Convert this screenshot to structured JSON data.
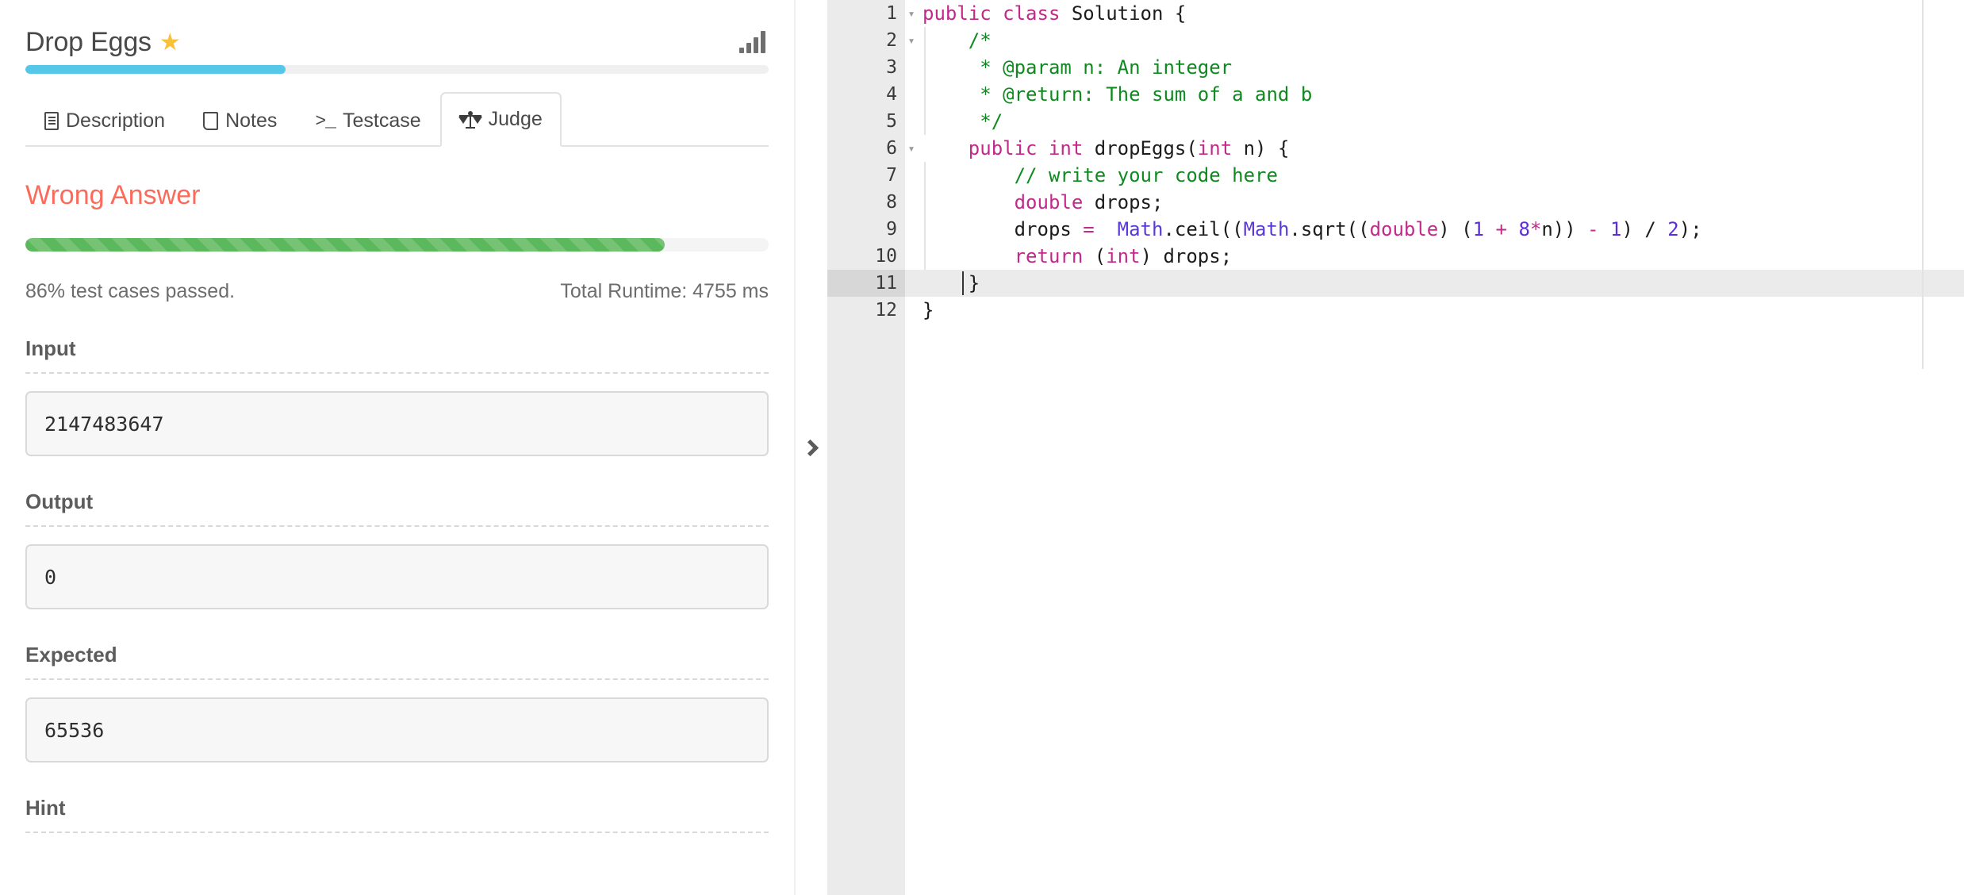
{
  "problem": {
    "title": "Drop Eggs",
    "star_icon": "star-icon",
    "favorite_marked": true,
    "signal_icon": "signal-bars-icon",
    "progress_percent": 35,
    "progress_color": "#55c8ea"
  },
  "tabs": [
    {
      "label": "Description",
      "icon": "document-icon",
      "active": false
    },
    {
      "label": "Notes",
      "icon": "note-icon",
      "active": false
    },
    {
      "label": "Testcase",
      "icon": "terminal-icon",
      "active": false
    },
    {
      "label": "Judge",
      "icon": "scales-icon",
      "active": true
    }
  ],
  "judge": {
    "verdict": "Wrong Answer",
    "verdict_color": "#fb6b5b",
    "pass_percent": 86,
    "pass_bar_color": "#5cb85c",
    "cases_passed_text": "86% test cases passed.",
    "runtime_text": "Total Runtime: 4755 ms",
    "sections": [
      {
        "label": "Input",
        "value": "2147483647"
      },
      {
        "label": "Output",
        "value": "0"
      },
      {
        "label": "Expected",
        "value": "65536"
      },
      {
        "label": "Hint",
        "value": ""
      }
    ]
  },
  "divider": {
    "collapse_icon": "chevron-right-icon"
  },
  "editor": {
    "language": "java",
    "active_line": 11,
    "total_lines": 12,
    "lines": [
      {
        "n": 1,
        "fold": true,
        "tokens": [
          {
            "t": "public class ",
            "c": "k"
          },
          {
            "t": "Solution {",
            "c": "pl"
          }
        ]
      },
      {
        "n": 2,
        "fold": true,
        "tokens": [
          {
            "t": "    ",
            "c": "pl"
          },
          {
            "t": "/*",
            "c": "cm"
          }
        ]
      },
      {
        "n": 3,
        "fold": false,
        "tokens": [
          {
            "t": "     ",
            "c": "pl"
          },
          {
            "t": "* @param n: An integer",
            "c": "cm"
          }
        ]
      },
      {
        "n": 4,
        "fold": false,
        "tokens": [
          {
            "t": "     ",
            "c": "pl"
          },
          {
            "t": "* @return: The sum of a and b",
            "c": "cm"
          }
        ]
      },
      {
        "n": 5,
        "fold": false,
        "tokens": [
          {
            "t": "     ",
            "c": "pl"
          },
          {
            "t": "*/",
            "c": "cm"
          }
        ]
      },
      {
        "n": 6,
        "fold": true,
        "tokens": [
          {
            "t": "    ",
            "c": "pl"
          },
          {
            "t": "public int ",
            "c": "k"
          },
          {
            "t": "dropEggs(",
            "c": "pl"
          },
          {
            "t": "int",
            "c": "k"
          },
          {
            "t": " n) {",
            "c": "pl"
          }
        ]
      },
      {
        "n": 7,
        "fold": false,
        "tokens": [
          {
            "t": "        ",
            "c": "pl"
          },
          {
            "t": "// write your code here",
            "c": "cm"
          }
        ]
      },
      {
        "n": 8,
        "fold": false,
        "tokens": [
          {
            "t": "        ",
            "c": "pl"
          },
          {
            "t": "double",
            "c": "k"
          },
          {
            "t": " drops;",
            "c": "pl"
          }
        ]
      },
      {
        "n": 9,
        "fold": false,
        "tokens": [
          {
            "t": "        drops ",
            "c": "pl"
          },
          {
            "t": "=",
            "c": "op"
          },
          {
            "t": "  ",
            "c": "pl"
          },
          {
            "t": "Math",
            "c": "cls"
          },
          {
            "t": ".ceil((",
            "c": "pl"
          },
          {
            "t": "Math",
            "c": "cls"
          },
          {
            "t": ".sqrt((",
            "c": "pl"
          },
          {
            "t": "double",
            "c": "k"
          },
          {
            "t": ") (",
            "c": "pl"
          },
          {
            "t": "1",
            "c": "num"
          },
          {
            "t": " ",
            "c": "pl"
          },
          {
            "t": "+",
            "c": "op"
          },
          {
            "t": " ",
            "c": "pl"
          },
          {
            "t": "8",
            "c": "num"
          },
          {
            "t": "*",
            "c": "op"
          },
          {
            "t": "n)) ",
            "c": "pl"
          },
          {
            "t": "-",
            "c": "op"
          },
          {
            "t": " ",
            "c": "pl"
          },
          {
            "t": "1",
            "c": "num"
          },
          {
            "t": ") / ",
            "c": "pl"
          },
          {
            "t": "2",
            "c": "num"
          },
          {
            "t": ");",
            "c": "pl"
          }
        ]
      },
      {
        "n": 10,
        "fold": false,
        "tokens": [
          {
            "t": "        ",
            "c": "pl"
          },
          {
            "t": "return",
            "c": "k"
          },
          {
            "t": " (",
            "c": "pl"
          },
          {
            "t": "int",
            "c": "k"
          },
          {
            "t": ") drops;",
            "c": "pl"
          }
        ]
      },
      {
        "n": 11,
        "fold": false,
        "tokens": [
          {
            "t": "    }",
            "c": "pl"
          }
        ]
      },
      {
        "n": 12,
        "fold": false,
        "tokens": [
          {
            "t": "}",
            "c": "pl"
          }
        ]
      }
    ],
    "fold_glyph": "▾"
  }
}
